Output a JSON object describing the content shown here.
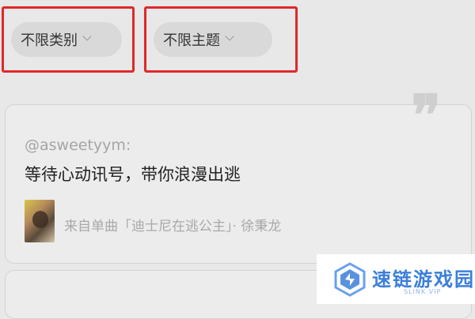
{
  "filters": {
    "category": {
      "label": "不限类别"
    },
    "theme": {
      "label": "不限主题"
    }
  },
  "card": {
    "quote_mark": "❞",
    "author": "@asweetyym:",
    "quote": "等待心动讯号，带你浪漫出逃",
    "source": "来自单曲「迪士尼在逃公主」· 徐秉龙"
  },
  "watermark": {
    "name": "速链游戏园",
    "sub": "SLINK.VIP"
  },
  "colors": {
    "highlight_border": "#e0282a",
    "watermark_blue": "#3b7fd9"
  }
}
